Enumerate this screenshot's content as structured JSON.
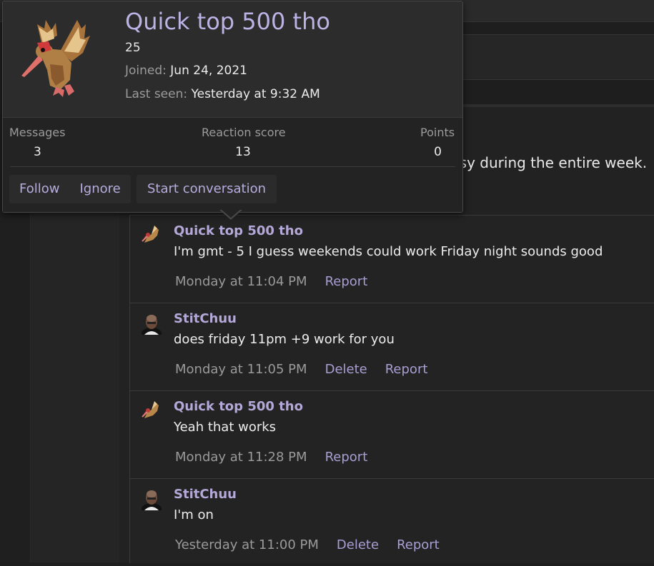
{
  "profile_card": {
    "username": "Quick top 500 tho",
    "subtitle": "25",
    "joined_label": "Joined:",
    "joined_value": "Jun 24, 2021",
    "last_seen_label": "Last seen:",
    "last_seen_value": "Yesterday at 9:32 AM",
    "avatar_icon": "bird-pixel-avatar-icon",
    "stats": {
      "messages_label": "Messages",
      "messages_value": "3",
      "reaction_label": "Reaction score",
      "reaction_value": "13",
      "points_label": "Points",
      "points_value": "0"
    },
    "buttons": {
      "follow": "Follow",
      "ignore": "Ignore",
      "start_conversation": "Start conversation"
    }
  },
  "first_post": {
    "text_fragment": "usy during the entire week."
  },
  "replies": [
    {
      "username": "Quick top 500 tho",
      "avatar_icon": "bird-pixel-avatar-icon",
      "message": "I'm gmt - 5 I guess weekends could work Friday night sounds good",
      "time": "Monday at 11:04 PM",
      "delete": "",
      "report": "Report"
    },
    {
      "username": "StitChuu",
      "avatar_icon": "person-avatar-icon",
      "message": "does friday 11pm +9 work for you",
      "time": "Monday at 11:05 PM",
      "delete": "Delete",
      "report": "Report"
    },
    {
      "username": "Quick top 500 tho",
      "avatar_icon": "bird-pixel-avatar-icon",
      "message": "Yeah that works",
      "time": "Monday at 11:28 PM",
      "delete": "",
      "report": "Report"
    },
    {
      "username": "StitChuu",
      "avatar_icon": "person-avatar-icon",
      "message": "I'm on",
      "time": "Yesterday at 11:00 PM",
      "delete": "Delete",
      "report": "Report"
    }
  ],
  "colors": {
    "accent_link": "#a99ed3",
    "username": "#b4a8d8",
    "background": "#1e1e1e"
  }
}
